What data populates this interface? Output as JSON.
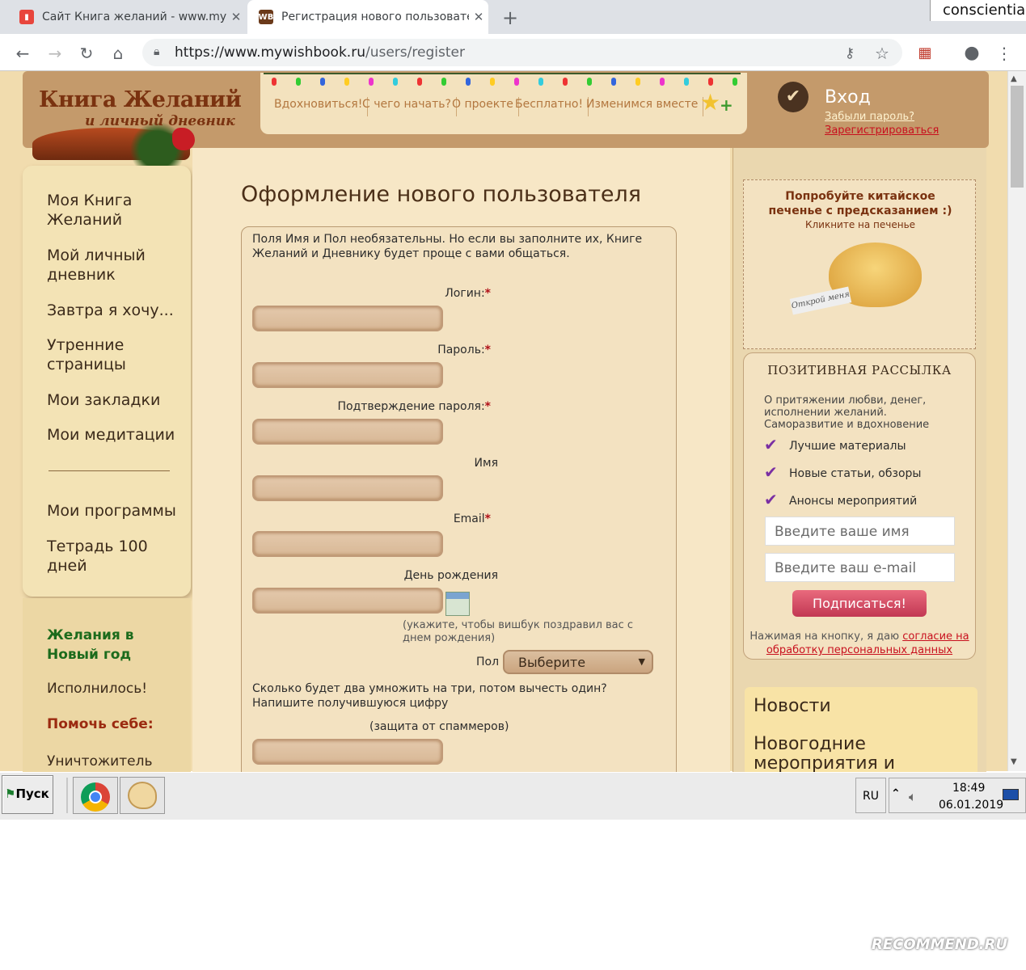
{
  "browser": {
    "tabs": [
      {
        "title": "Сайт Книга желаний - www.mywishbook.ru",
        "favicon": "bookmark-icon",
        "color": "#e8453c"
      },
      {
        "title": "Регистрация нового пользователя",
        "favicon": "WB",
        "color": "#6b3a1a"
      }
    ],
    "new_tab": "+",
    "profile_chip": "conscientia",
    "url_host": "https://www.mywishbook.ru",
    "url_path": "/users/register"
  },
  "site": {
    "logo_main": "Книга Желаний",
    "logo_sub": "и личный дневник",
    "nav": [
      "Вдохновиться!",
      "С чего начать?",
      "О проекте",
      "Бесплатно!",
      "Изменимся вместе"
    ],
    "login": {
      "title": "Вход",
      "forgot": "Забыли пароль?",
      "register": "Зарегистрироваться"
    }
  },
  "sidebar": {
    "items": [
      "Моя Книга Желаний",
      "Мой личный дневник",
      "Завтра я хочу...",
      "Утренние страницы",
      "Мои закладки",
      "Мои медитации",
      "Мои программы",
      "Тетрадь 100 дней"
    ],
    "lower": [
      {
        "text": "Желания в Новый год",
        "color": "#1c6b1c",
        "bold": true
      },
      {
        "text": "Исполнилось!",
        "color": "#3b2a1a",
        "bold": false
      },
      {
        "text": "Помочь себе:",
        "color": "#9b2a10",
        "bold": true
      },
      {
        "text": "Уничтожитель",
        "color": "#3b2a1a",
        "bold": false
      }
    ]
  },
  "form": {
    "title": "Оформление нового пользователя",
    "intro": "Поля Имя и Пол необязательны. Но если вы заполните их, Книге Желаний и Дневнику будет проще с вами общаться.",
    "required_mark": "*",
    "fields": {
      "login": "Логин:",
      "password": "Пароль:",
      "password_confirm": "Подтверждение пароля:",
      "name": "Имя",
      "email": "Email",
      "birthday": "День рождения"
    },
    "birthday_hint": "(укажите, чтобы вишбук поздравил вас с днем рождения)",
    "gender_label": "Пол",
    "gender_value": "Выберите",
    "captcha_question": "Сколько будет два умножить на три, потом вычесть один? Напишите получившуюся цифру",
    "captcha_note": "(защита от спаммеров)"
  },
  "fortune": {
    "title": "Попробуйте китайское печенье с предсказанием :)",
    "subtitle": "Кликните на печенье",
    "paper": "Открой меня"
  },
  "newsletter": {
    "title": "ПОЗИТИВНАЯ РАССЫЛКА",
    "description": "О притяжении любви, денег, исполнении желаний. Саморазвитие и вдохновение",
    "items": [
      "Лучшие материалы",
      "Новые статьи, обзоры",
      "Анонсы мероприятий"
    ],
    "name_placeholder": "Введите ваше имя",
    "email_placeholder": "Введите ваш e-mail",
    "button": "Подписаться!",
    "consent_text": "Нажимая на кнопку, я даю",
    "consent_link": "согласие на обработку персональных данных"
  },
  "news": {
    "title": "Новости",
    "item": "Новогодние мероприятия и"
  },
  "taskbar": {
    "start": "Пуск",
    "lang": "RU",
    "time": "18:49",
    "date": "06.01.2019"
  },
  "watermark": "RECOMMEND.RU"
}
